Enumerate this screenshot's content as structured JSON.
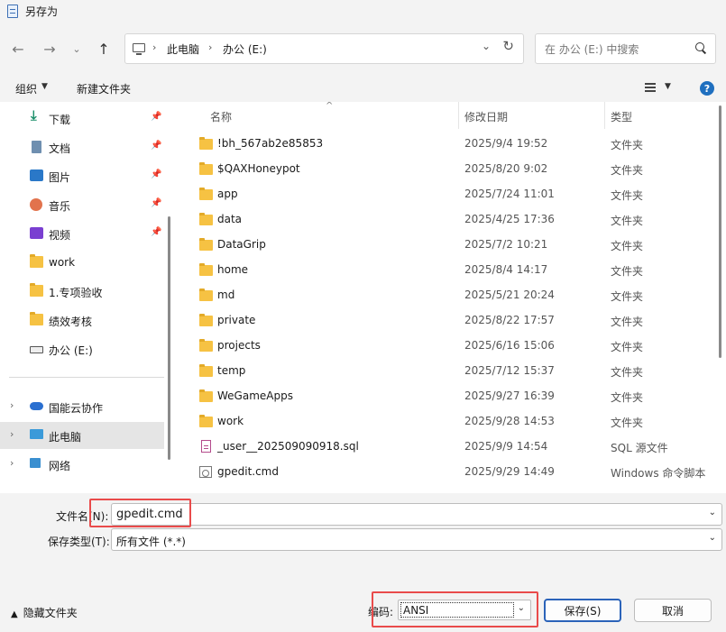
{
  "window": {
    "title": "另存为"
  },
  "address": {
    "crumbs": [
      "此电脑",
      "办公 (E:)"
    ],
    "search_placeholder": "在 办公 (E:) 中搜索"
  },
  "toolbar": {
    "organize": "组织",
    "new_folder": "新建文件夹",
    "help": "?"
  },
  "sidebar": {
    "items": [
      {
        "label": "下载",
        "icon": "download-icon",
        "pinned": true
      },
      {
        "label": "文档",
        "icon": "document-icon",
        "pinned": true
      },
      {
        "label": "图片",
        "icon": "picture-icon",
        "pinned": true
      },
      {
        "label": "音乐",
        "icon": "music-icon",
        "pinned": true
      },
      {
        "label": "视频",
        "icon": "video-icon",
        "pinned": true
      },
      {
        "label": "work",
        "icon": "folder-icon",
        "pinned": false
      },
      {
        "label": "1.专项验收",
        "icon": "folder-icon",
        "pinned": false
      },
      {
        "label": "绩效考核",
        "icon": "folder-icon",
        "pinned": false
      },
      {
        "label": "办公 (E:)",
        "icon": "drive-icon",
        "pinned": false
      }
    ],
    "tree": [
      {
        "label": "国能云协作",
        "icon": "cloud-icon",
        "selected": false
      },
      {
        "label": "此电脑",
        "icon": "computer-icon",
        "selected": true
      },
      {
        "label": "网络",
        "icon": "network-icon",
        "selected": false
      }
    ]
  },
  "filelist": {
    "columns": [
      "名称",
      "修改日期",
      "类型"
    ],
    "rows": [
      {
        "name": "!bh_567ab2e85853",
        "date": "2025/9/4 19:52",
        "type": "文件夹",
        "icon": "folder-icon"
      },
      {
        "name": "$QAXHoneypot",
        "date": "2025/8/20 9:02",
        "type": "文件夹",
        "icon": "folder-icon"
      },
      {
        "name": "app",
        "date": "2025/7/24 11:01",
        "type": "文件夹",
        "icon": "folder-icon"
      },
      {
        "name": "data",
        "date": "2025/4/25 17:36",
        "type": "文件夹",
        "icon": "folder-icon"
      },
      {
        "name": "DataGrip",
        "date": "2025/7/2 10:21",
        "type": "文件夹",
        "icon": "folder-icon"
      },
      {
        "name": "home",
        "date": "2025/8/4 14:17",
        "type": "文件夹",
        "icon": "folder-icon"
      },
      {
        "name": "md",
        "date": "2025/5/21 20:24",
        "type": "文件夹",
        "icon": "folder-icon"
      },
      {
        "name": "private",
        "date": "2025/8/22 17:57",
        "type": "文件夹",
        "icon": "folder-icon"
      },
      {
        "name": "projects",
        "date": "2025/6/16 15:06",
        "type": "文件夹",
        "icon": "folder-icon"
      },
      {
        "name": "temp",
        "date": "2025/7/12 15:37",
        "type": "文件夹",
        "icon": "folder-icon"
      },
      {
        "name": "WeGameApps",
        "date": "2025/9/27 16:39",
        "type": "文件夹",
        "icon": "folder-icon"
      },
      {
        "name": "work",
        "date": "2025/9/28 14:53",
        "type": "文件夹",
        "icon": "folder-icon"
      },
      {
        "name": "_user__202509090918.sql",
        "date": "2025/9/9 14:54",
        "type": "SQL 源文件",
        "icon": "sql-file-icon"
      },
      {
        "name": "gpedit.cmd",
        "date": "2025/9/29 14:49",
        "type": "Windows 命令脚本",
        "icon": "cmd-file-icon"
      }
    ]
  },
  "form": {
    "filename_label": "文件名(N):",
    "filename_value": "gpedit.cmd",
    "filetype_label": "保存类型(T):",
    "filetype_value": "所有文件 (*.*)",
    "encoding_label": "编码:",
    "encoding_value": "ANSI",
    "hide_folders": "隐藏文件夹",
    "save": "保存(S)",
    "cancel": "取消"
  },
  "colors": {
    "accent": "#2b63b9",
    "highlight_box": "#e94b4b",
    "folder": "#f6c243"
  }
}
